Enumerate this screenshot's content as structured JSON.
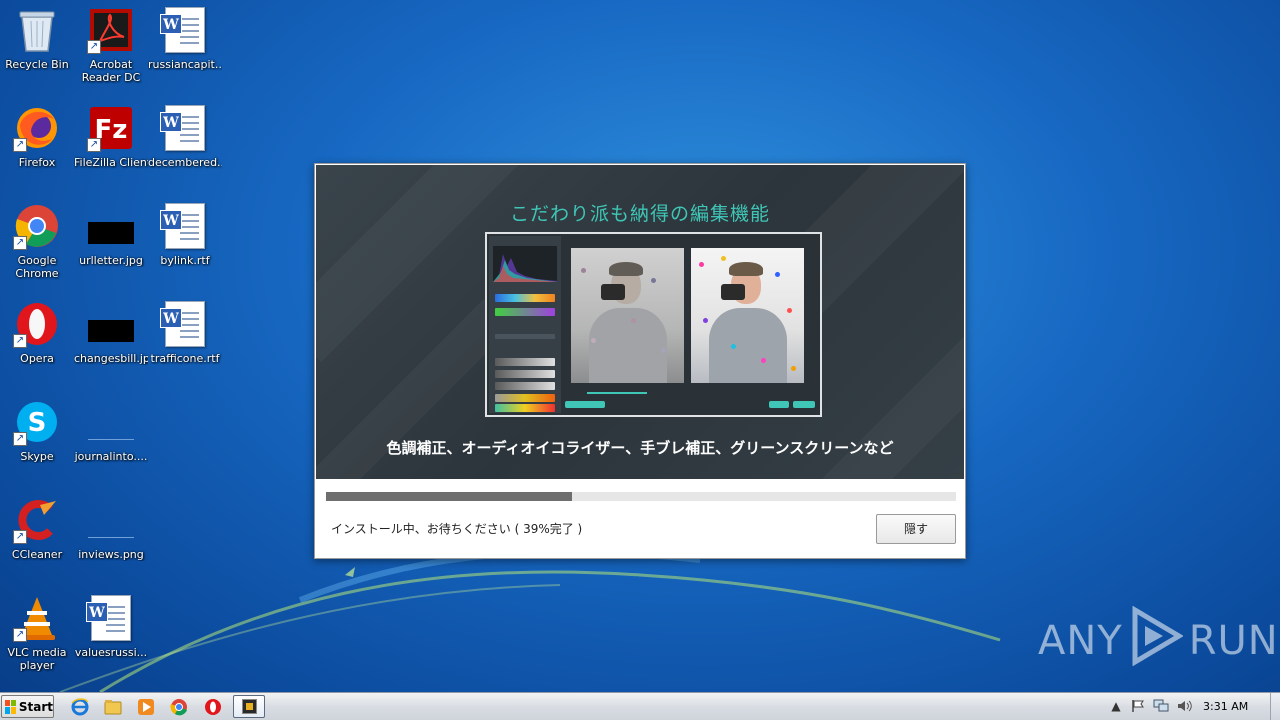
{
  "desktop": {
    "icons": [
      {
        "label": "Recycle Bin",
        "icon": "recycle-bin-icon"
      },
      {
        "label": "Acrobat Reader DC",
        "icon": "acrobat-icon"
      },
      {
        "label": "russiancapit....",
        "icon": "word-doc-icon"
      },
      {
        "label": "Firefox",
        "icon": "firefox-icon"
      },
      {
        "label": "FileZilla Client",
        "icon": "filezilla-icon"
      },
      {
        "label": "decembered....",
        "icon": "word-doc-icon"
      },
      {
        "label": "Google Chrome",
        "icon": "chrome-icon"
      },
      {
        "label": "urlletter.jpg",
        "icon": "image-file-icon"
      },
      {
        "label": "bylink.rtf",
        "icon": "word-doc-icon"
      },
      {
        "label": "Opera",
        "icon": "opera-icon"
      },
      {
        "label": "changesbill.jpg",
        "icon": "image-file-icon"
      },
      {
        "label": "trafficone.rtf",
        "icon": "word-doc-icon"
      },
      {
        "label": "Skype",
        "icon": "skype-icon"
      },
      {
        "label": "journalinto....",
        "icon": "image-file-icon"
      },
      {
        "label": "CCleaner",
        "icon": "ccleaner-icon"
      },
      {
        "label": "inviews.png",
        "icon": "image-file-icon"
      },
      {
        "label": "VLC media player",
        "icon": "vlc-icon"
      },
      {
        "label": "valuesrussi...",
        "icon": "word-doc-icon"
      }
    ]
  },
  "installer": {
    "banner_title": "こだわり派も納得の編集機能",
    "banner_subtitle": "色調補正、オーディオイコライザー、手ブレ補正、グリーンスクリーンなど",
    "progress_percent": 39,
    "status_text": "インストール中、お待ちください ( 39%完了 )",
    "hide_button_label": "隠す",
    "colors": {
      "accent": "#3fc6b6",
      "progress": "#6e6e6e",
      "banner_bg": "#323b41"
    }
  },
  "watermark": {
    "left": "ANY",
    "right": "RUN"
  },
  "taskbar": {
    "start_label": "Start",
    "pinned": [
      "ie-icon",
      "explorer-icon",
      "media-player-icon",
      "chrome-icon",
      "opera-icon",
      "installer-icon"
    ],
    "tray": [
      "show-hidden-icon",
      "flag-icon",
      "network-icon",
      "volume-icon"
    ],
    "clock": "3:31 AM"
  }
}
